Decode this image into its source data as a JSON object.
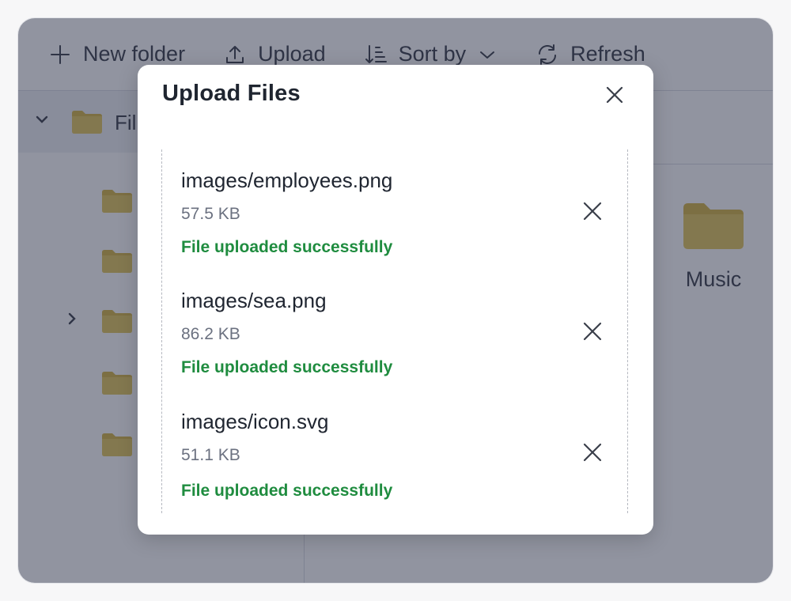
{
  "toolbar": {
    "new_folder_label": "New folder",
    "upload_label": "Upload",
    "sort_label": "Sort by",
    "refresh_label": "Refresh",
    "icons": [
      "plus-icon",
      "upload-icon",
      "sort-icon",
      "chevron-down-icon",
      "refresh-icon"
    ]
  },
  "sidebar": {
    "root_label": "Fil",
    "folder_count": 5
  },
  "content": {
    "folder_label": "Music"
  },
  "modal": {
    "title": "Upload Files",
    "files": [
      {
        "name": "images/employees.png",
        "size": "57.5 KB",
        "status": "File uploaded successfully"
      },
      {
        "name": "images/sea.png",
        "size": "86.2 KB",
        "status": "File uploaded successfully"
      },
      {
        "name": "images/icon.svg",
        "size": "51.1 KB",
        "status": "File uploaded successfully"
      }
    ]
  },
  "colors": {
    "overlay": "#232a42",
    "success": "#1f8c3f",
    "folder": "#e3c75c"
  }
}
